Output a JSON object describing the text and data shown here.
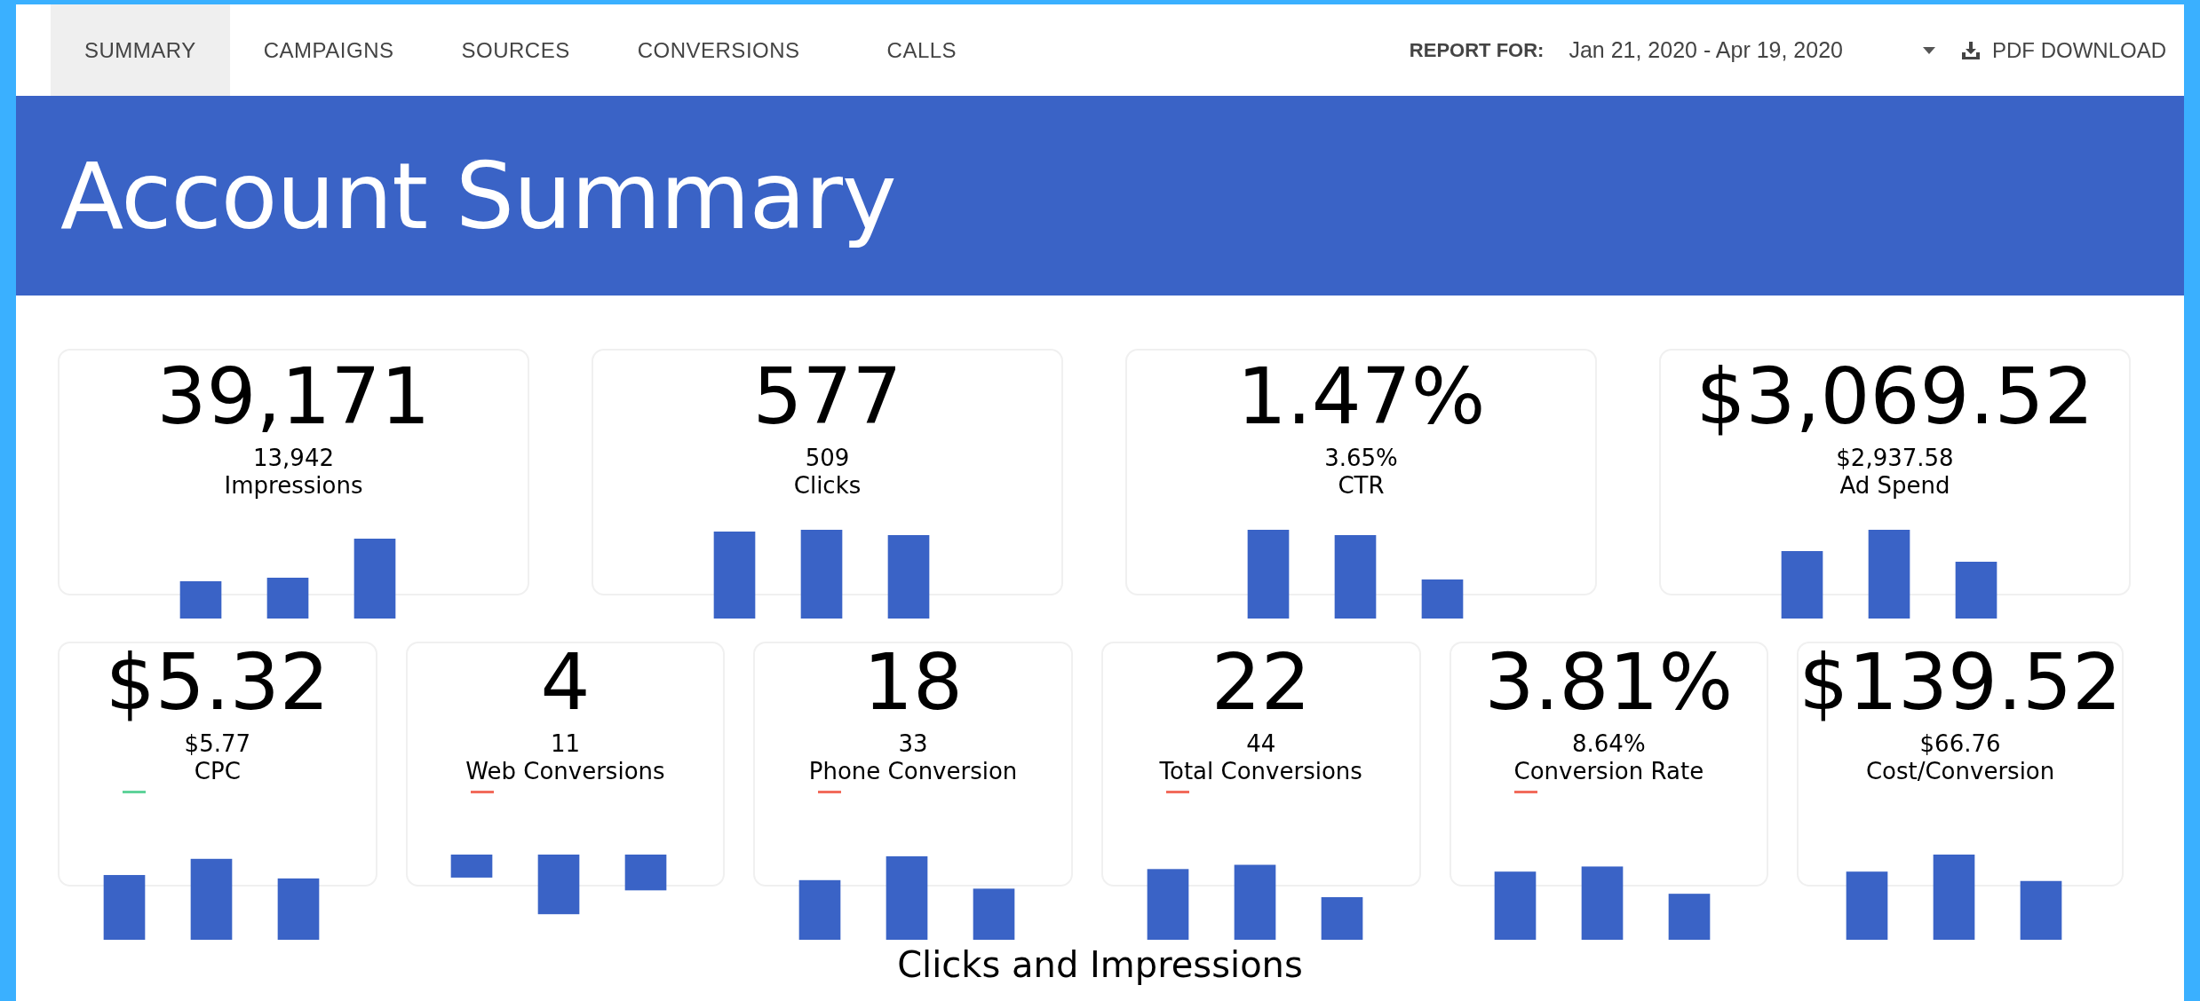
{
  "nav": {
    "tabs": [
      {
        "label": "SUMMARY",
        "selected": true
      },
      {
        "label": "CAMPAIGNS",
        "selected": false
      },
      {
        "label": "SOURCES",
        "selected": false
      },
      {
        "label": "CONVERSIONS",
        "selected": false
      },
      {
        "label": "CALLS",
        "selected": false
      }
    ],
    "report_label": "REPORT FOR:",
    "date_range": "Jan 21, 2020 - Apr 19, 2020",
    "download": "PDF DOWNLOAD"
  },
  "header": {
    "title": "Account Summary"
  },
  "metrics_top": [
    {
      "value": "39,171",
      "previous": "13,942",
      "label": "Impressions"
    },
    {
      "value": "577",
      "previous": "509",
      "label": "Clicks"
    },
    {
      "value": "1.47%",
      "previous": "3.65%",
      "label": "CTR"
    },
    {
      "value": "$3,069.52",
      "previous": "$2,937.58",
      "label": "Ad Spend"
    }
  ],
  "metrics_bottom": [
    {
      "value": "$5.32",
      "previous": "$5.77",
      "label": "CPC",
      "color": "#5fd39a"
    },
    {
      "value": "4",
      "previous": "11",
      "label": "Web Conversions",
      "color": "#f26b5b"
    },
    {
      "value": "18",
      "previous": "33",
      "label": "Phone Conversion",
      "color": "#f26b5b"
    },
    {
      "value": "22",
      "previous": "44",
      "label": "Total Conversions",
      "color": "#f26b5b"
    },
    {
      "value": "3.81%",
      "previous": "8.64%",
      "label": "Conversion Rate",
      "color": "#f26b5b"
    },
    {
      "value": "$139.52",
      "previous": "$66.76",
      "label": "Cost/Conversion"
    }
  ],
  "chart_title": "Clicks and Impressions"
}
